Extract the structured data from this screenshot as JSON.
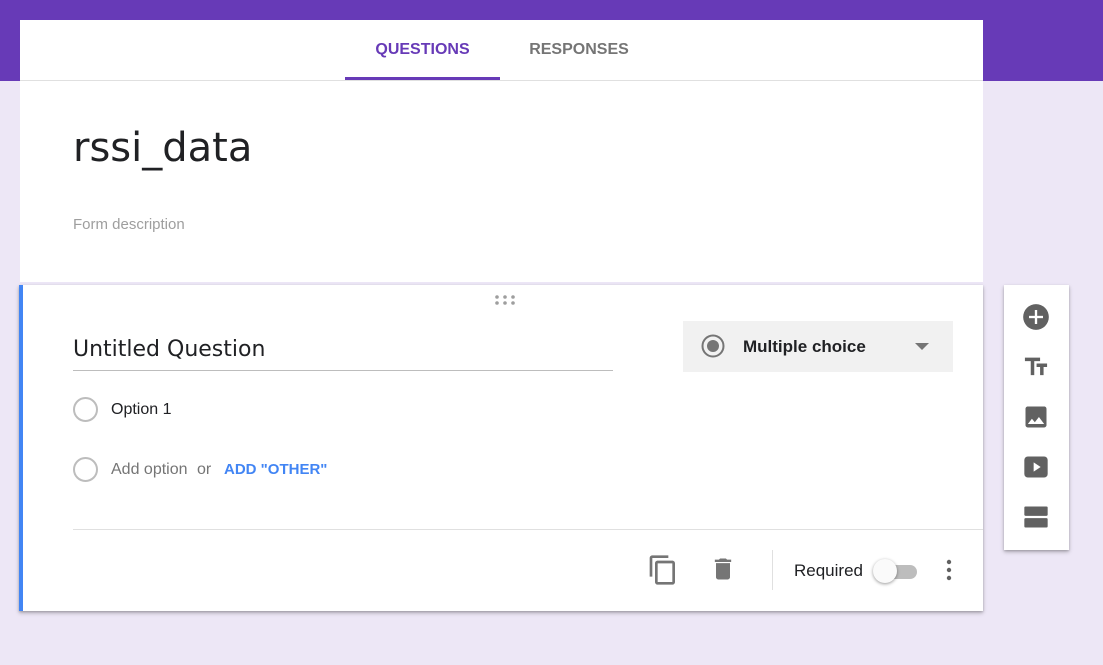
{
  "tabs": [
    {
      "label": "QUESTIONS",
      "active": true
    },
    {
      "label": "RESPONSES",
      "active": false
    }
  ],
  "form": {
    "title": "rssi_data",
    "description_placeholder": "Form description"
  },
  "question": {
    "title": "Untitled Question",
    "type": "Multiple choice",
    "options": [
      "Option 1"
    ],
    "add_option": "Add option",
    "or": "or",
    "add_other": "ADD \"OTHER\"",
    "required_label": "Required",
    "required": false
  },
  "side_toolbar": {
    "tools": [
      "add-question-icon",
      "title-text-icon",
      "image-icon",
      "video-icon",
      "section-icon"
    ]
  },
  "colors": {
    "brand": "#673ab7",
    "background": "#ede7f6",
    "focus": "#4285f4"
  }
}
